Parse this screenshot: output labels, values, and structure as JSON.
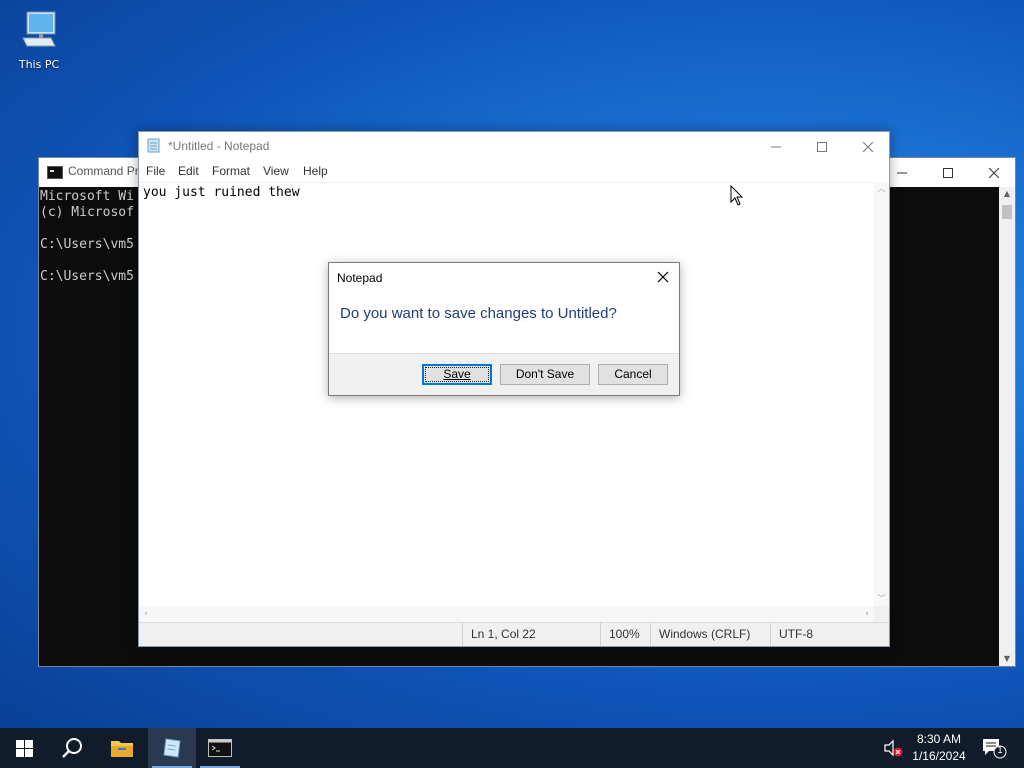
{
  "desktop": {
    "icons": [
      {
        "label": "This PC",
        "icon": "computer-icon"
      }
    ]
  },
  "cmd_window": {
    "title": "Command Pr",
    "icon": "cmd-icon",
    "lines": [
      "Microsoft Wi",
      "(c) Microsof",
      "",
      "C:\\Users\\vm5",
      "",
      "C:\\Users\\vm5"
    ]
  },
  "notepad": {
    "title": "*Untitled - Notepad",
    "icon": "notepad-icon",
    "menu": [
      "File",
      "Edit",
      "Format",
      "View",
      "Help"
    ],
    "content": "you just ruined thew",
    "status": {
      "position": "Ln 1, Col 22",
      "zoom": "100%",
      "line_ending": "Windows (CRLF)",
      "encoding": "UTF-8"
    }
  },
  "dialog": {
    "title": "Notepad",
    "message": "Do you want to save changes to Untitled?",
    "buttons": {
      "save": "Save",
      "dont_save": "Don't Save",
      "cancel": "Cancel"
    }
  },
  "taskbar": {
    "items": [
      "start-icon",
      "search-icon",
      "file-explorer-icon",
      "notepad-icon",
      "cmd-icon"
    ],
    "clock": {
      "time": "8:30 AM",
      "date": "1/16/2024"
    },
    "notification_count": "1",
    "volume_icon": "volume-muted-icon"
  },
  "colors": {
    "accent": "#0078d7",
    "taskbar": "#101c2c",
    "dialog_message": "#1f3d7a"
  }
}
